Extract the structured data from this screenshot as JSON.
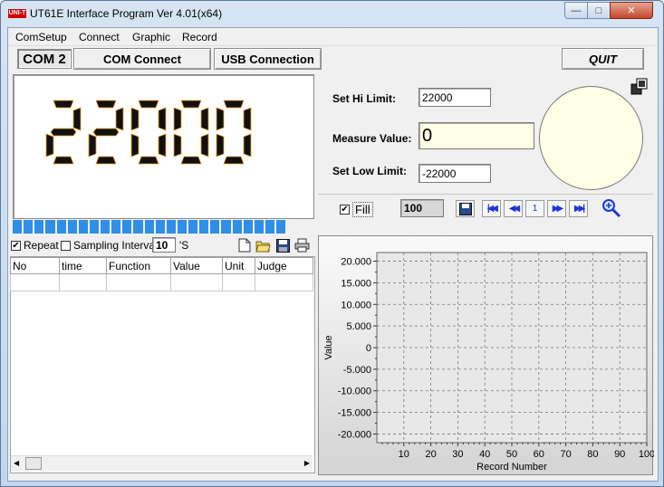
{
  "window": {
    "title": "UT61E Interface Program Ver 4.01(x64)",
    "logo_text": "UNI-T",
    "minimize_glyph": "—",
    "maximize_glyph": "□",
    "close_glyph": "✕"
  },
  "menu": [
    "ComSetup",
    "Connect",
    "Graphic",
    "Record"
  ],
  "toolbar": {
    "com_port": "COM 2",
    "com_connect": "COM Connect",
    "usb_connection": "USB Connection",
    "quit": "QUIT"
  },
  "display": {
    "reading": "22000",
    "bar_segments": 25
  },
  "limits": {
    "hi_label": "Set Hi Limit:",
    "hi_value": "22000",
    "measure_label": "Measure Value:",
    "measure_value": "0",
    "low_label": "Set Low Limit:",
    "low_value": "-22000"
  },
  "record_controls": {
    "repeat_label": "Repeat",
    "repeat_checked": true,
    "sampling_label": "Sampling Interval",
    "sampling_checked": false,
    "sampling_value": "10",
    "sampling_unit": "'S"
  },
  "table": {
    "columns": [
      "No",
      "time",
      "Function",
      "Value",
      "Unit",
      "Judge"
    ]
  },
  "chart_controls": {
    "fill_label": "Fill",
    "fill_checked": true,
    "count_value": "100",
    "page_value": "1"
  },
  "colors": {
    "lcd_segment": "#111111",
    "lcd_edge": "#f0a020",
    "progress": "#2f8fe6",
    "gauge_fill": "#ffffe6",
    "nav_blue": "#1a38d6"
  },
  "chart_data": {
    "type": "line",
    "xlabel": "Record Number",
    "ylabel": "Value",
    "xlim": [
      0,
      100
    ],
    "ylim": [
      -22000,
      22000
    ],
    "x_ticks": [
      "10",
      "20",
      "30",
      "40",
      "50",
      "60",
      "70",
      "80",
      "90",
      "100"
    ],
    "y_ticks": [
      "20.000",
      "15.000",
      "10.000",
      "5.000",
      "0",
      "-5.000",
      "-10.000",
      "-15.000",
      "-20.000"
    ],
    "grid": true,
    "series": []
  }
}
